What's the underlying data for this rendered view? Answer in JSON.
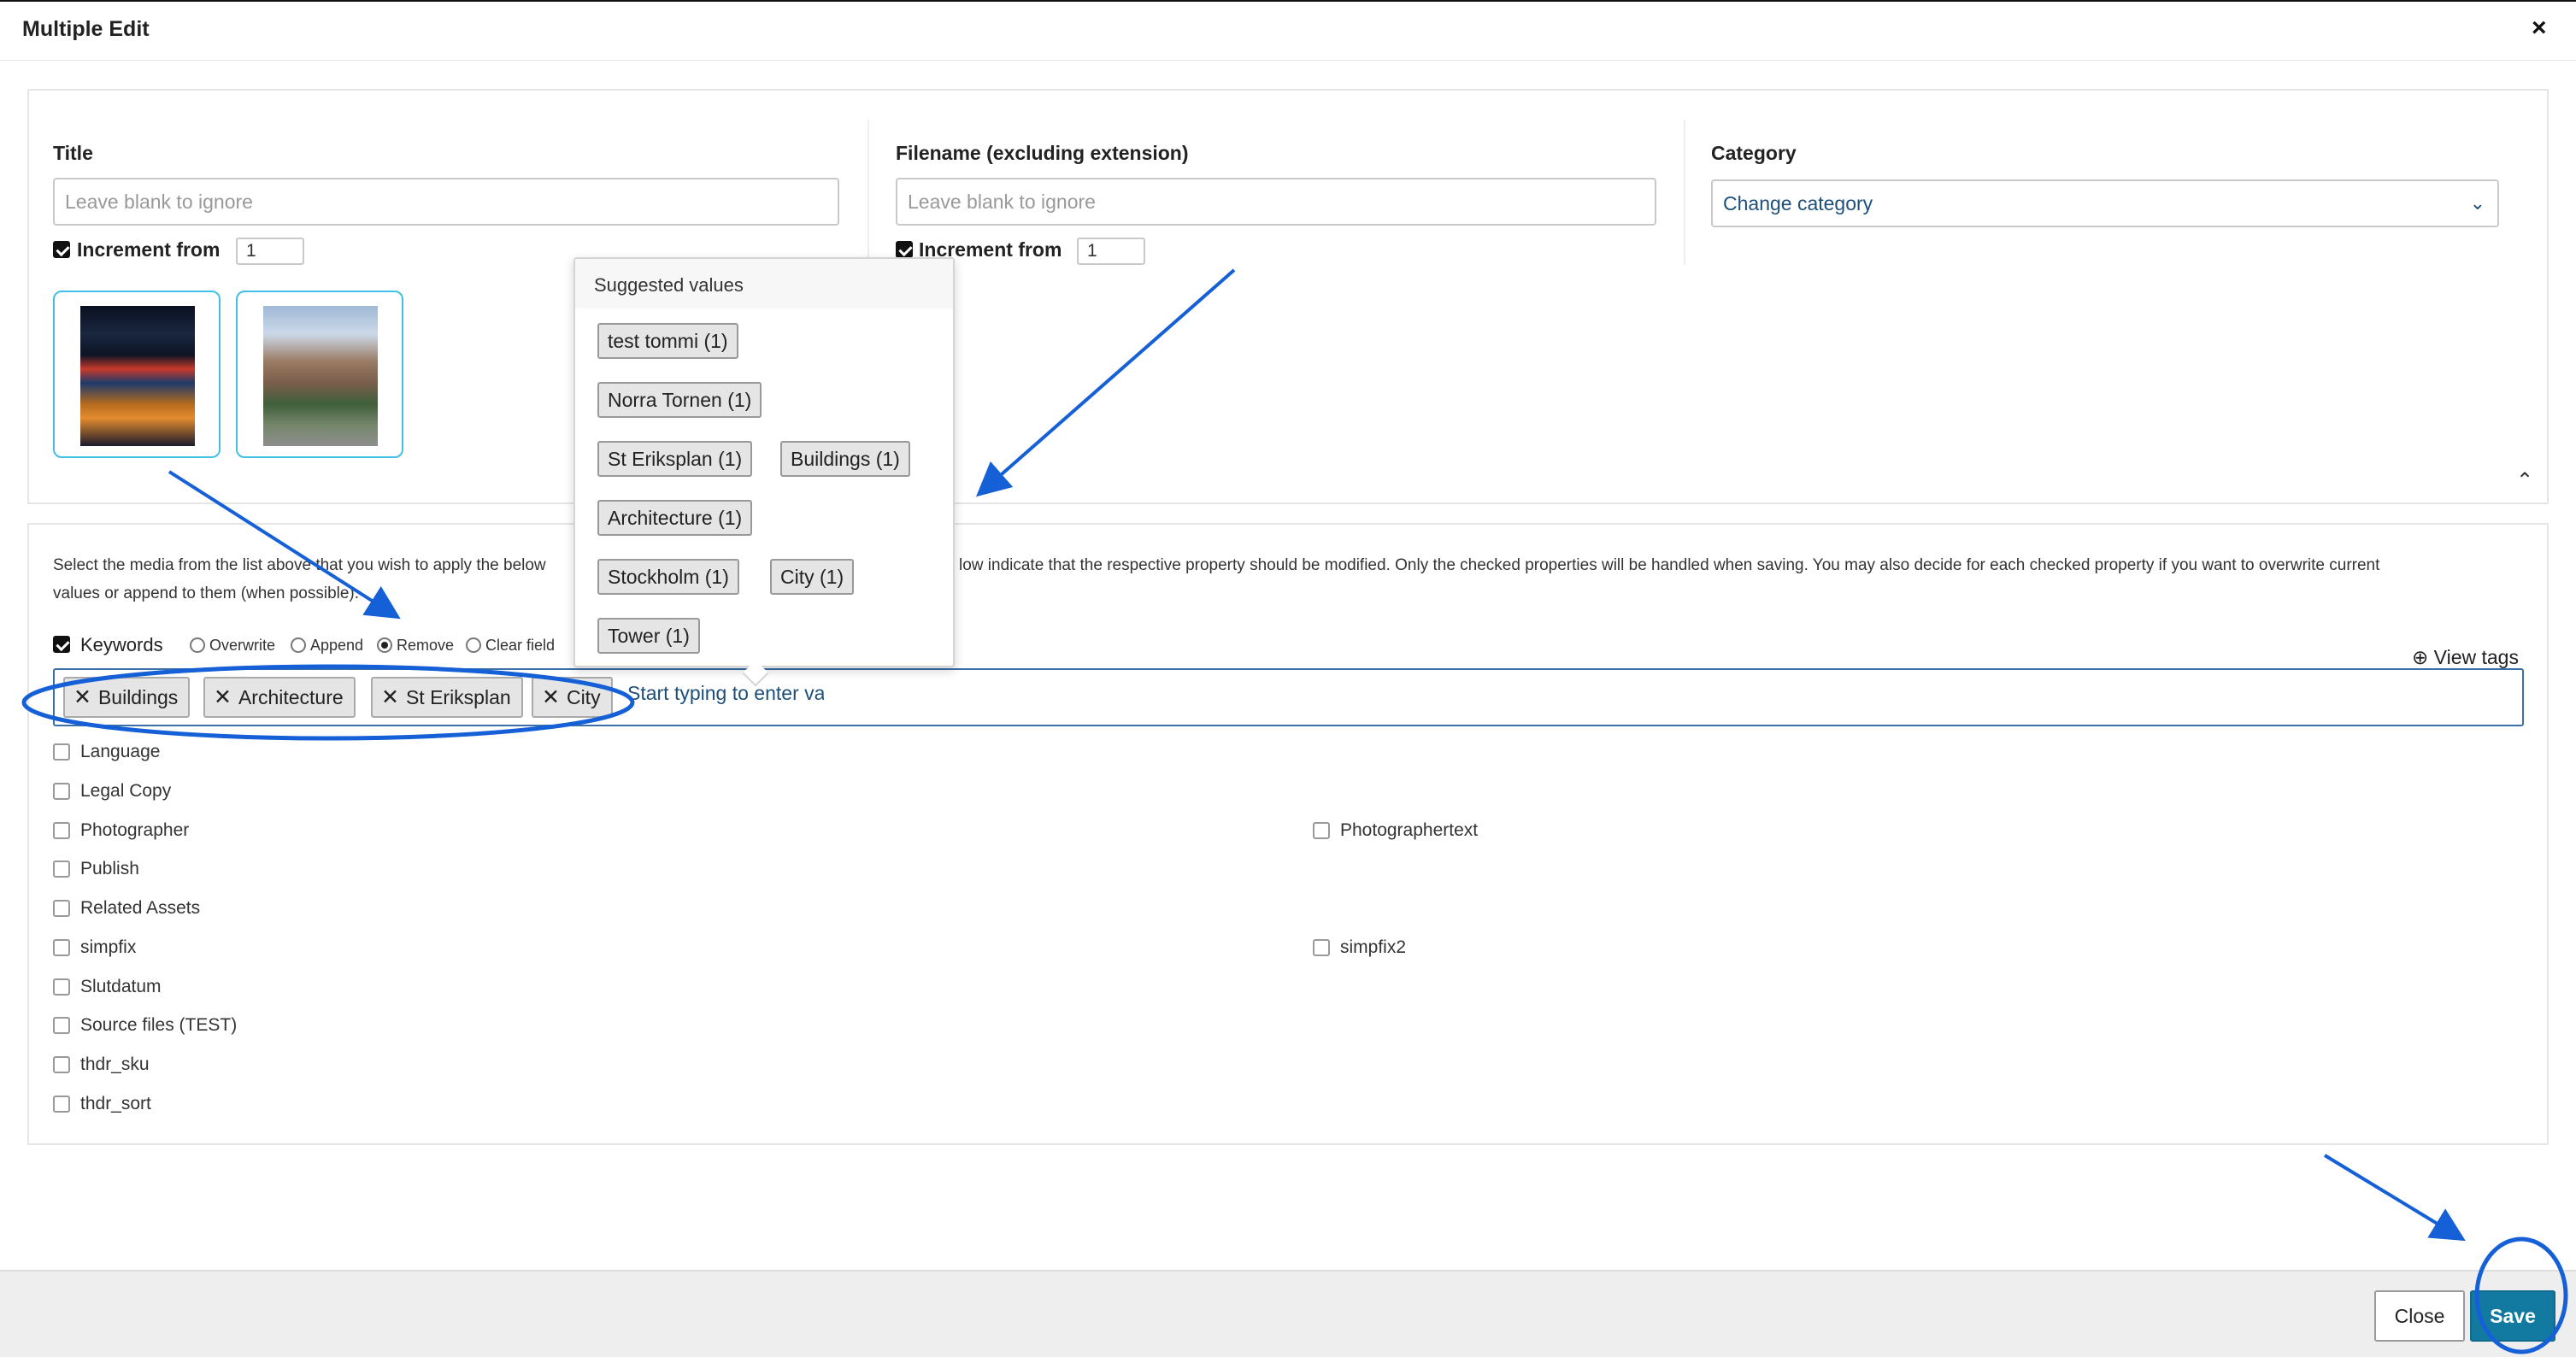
{
  "dialog": {
    "title": "Multiple Edit",
    "close_glyph": "×"
  },
  "fields": {
    "title": {
      "label": "Title",
      "placeholder": "Leave blank to ignore",
      "increment_label": "Increment from",
      "increment_value": "1",
      "increment_checked": true
    },
    "filename": {
      "label": "Filename (excluding extension)",
      "placeholder": "Leave blank to ignore",
      "increment_label": "Increment from",
      "increment_value": "1",
      "increment_checked": true
    },
    "category": {
      "label": "Category",
      "value": "Change category"
    }
  },
  "description": {
    "line1_left": "Select the media from the list above that you wish to apply the below",
    "line1_right": "low indicate that the respective property should be modified. Only the checked properties will be handled when saving. You may also decide for each checked property if you want to overwrite current",
    "line2": "values or append to them (when possible)."
  },
  "keywords": {
    "label": "Keywords",
    "checked": true,
    "modes": [
      "Overwrite",
      "Append",
      "Remove",
      "Clear field"
    ],
    "selected_mode": "Remove",
    "chips": [
      "Buildings",
      "Architecture",
      "St Eriksplan",
      "City"
    ],
    "input_text": "Start typing to enter va",
    "view_tags": "View tags"
  },
  "suggestions": {
    "header": "Suggested values",
    "items": [
      "test tommi (1)",
      "Norra Tornen (1)",
      "St Eriksplan (1)",
      "Buildings (1)",
      "Architecture (1)",
      "Stockholm (1)",
      "City (1)",
      "Tower (1)"
    ]
  },
  "properties": {
    "left": [
      "Language",
      "Legal Copy",
      "Photographer",
      "Publish",
      "Related Assets",
      "simpfix",
      "Slutdatum",
      "Source files (TEST)",
      "thdr_sku",
      "thdr_sort"
    ],
    "right": [
      "Photographertext",
      "simpfix2"
    ]
  },
  "footer": {
    "close_label": "Close",
    "save_label": "Save"
  },
  "colors": {
    "accent": "#127aa0",
    "annotation": "#1560d6",
    "thumb_border": "#40c0e4"
  }
}
